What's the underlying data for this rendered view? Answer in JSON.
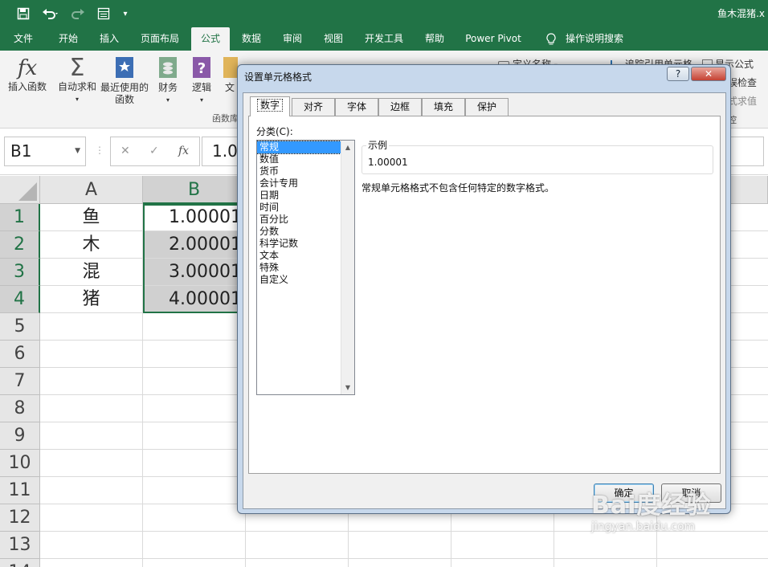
{
  "window": {
    "doc_title": "鱼木混猪.x"
  },
  "qat": {
    "save_icon": "save-icon",
    "undo_icon": "undo-icon",
    "redo_icon": "redo-icon",
    "form_icon": "form-icon",
    "customize_icon": "customize-qat-icon"
  },
  "tabs": [
    "文件",
    "开始",
    "插入",
    "页面布局",
    "公式",
    "数据",
    "审阅",
    "视图",
    "开发工具",
    "帮助",
    "Power Pivot",
    "操作说明搜索"
  ],
  "ribbon": {
    "insert_function": "插入函数",
    "autosum": "自动求和",
    "recent_line1": "最近使用的",
    "recent_line2": "函数",
    "finance": "财务",
    "logic": "逻辑",
    "text_partial": "文",
    "group_partial": "函数库",
    "define_name": "定义名称",
    "trace_precedents": "追踪引用单元格",
    "show_formulas": "显示公式",
    "error_check": "误检查",
    "evaluate": "式求值",
    "watch_partial": "控"
  },
  "formula_bar": {
    "name_box": "B1",
    "cancel_symbol": "✕",
    "enter_symbol": "✓",
    "fx_symbol": "fx",
    "value": "1.0"
  },
  "sheet": {
    "columns": [
      "A",
      "B"
    ],
    "rows": [
      "1",
      "2",
      "3",
      "4",
      "5",
      "6",
      "7",
      "8",
      "9",
      "10",
      "11",
      "12",
      "13",
      "14"
    ],
    "col_a": [
      "鱼",
      "木",
      "混",
      "猪"
    ],
    "col_b": [
      "1.00001",
      "2.00001",
      "3.00001",
      "4.00001"
    ]
  },
  "dialog": {
    "title": "设置单元格格式",
    "help": "?",
    "close": "✕",
    "tabs": [
      "数字",
      "对齐",
      "字体",
      "边框",
      "填充",
      "保护"
    ],
    "category_label": "分类(C):",
    "categories": [
      "常规",
      "数值",
      "货币",
      "会计专用",
      "日期",
      "时间",
      "百分比",
      "分数",
      "科学记数",
      "文本",
      "特殊",
      "自定义"
    ],
    "sample_label": "示例",
    "sample_value": "1.00001",
    "description": "常规单元格格式不包含任何特定的数字格式。",
    "ok": "确定",
    "cancel": "取消"
  },
  "watermark": {
    "brand": "Bai度经验",
    "url": "jingyan.baidu.com"
  }
}
